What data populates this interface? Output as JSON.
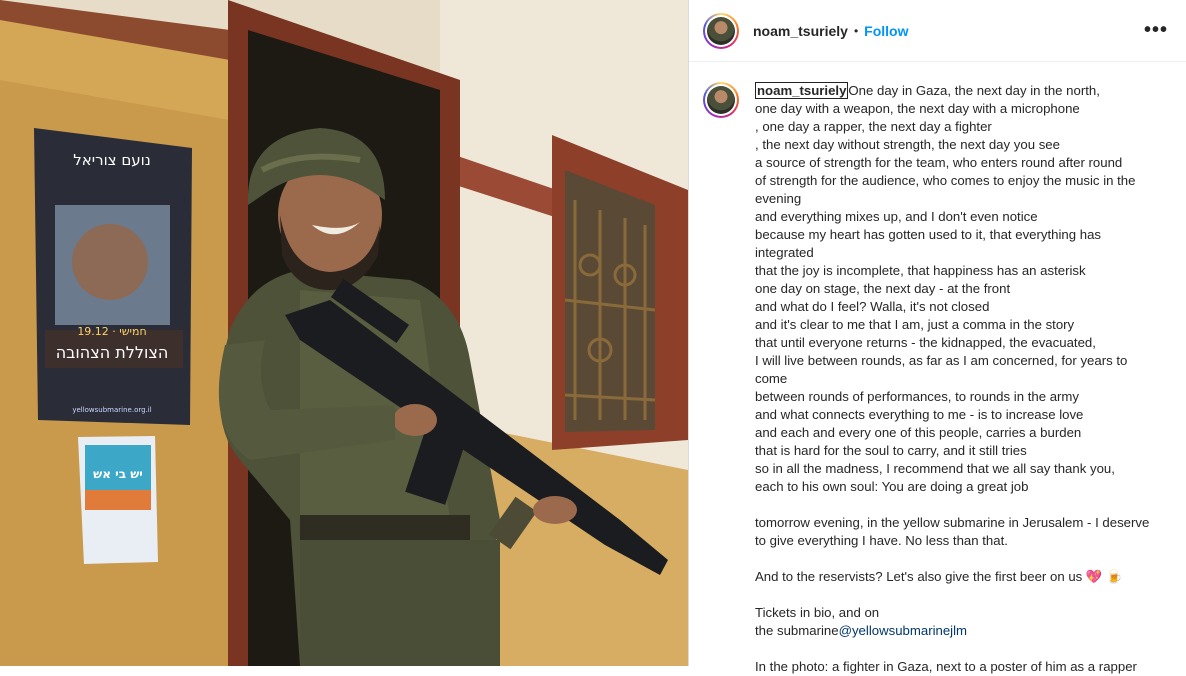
{
  "post": {
    "username": "noam_tsuriely",
    "separator": "•",
    "follow_label": "Follow",
    "more_icon": "more-options-icon",
    "more_glyph": "•••"
  },
  "photo": {
    "poster_heading": "נועם צוריאל",
    "poster_date": "19.12 · חמישי",
    "poster_title": "הצוללת הצהובה",
    "poster_url": "yellowsubmarine.org.il",
    "sticker_text": "יש בי אש"
  },
  "caption": {
    "lines": [
      "One day in Gaza, the next day in the north,",
      "one day with a weapon, the next day with a microphone",
      ", one day a rapper, the next day a fighter",
      ", the next day without strength, the next day you see",
      "a source of strength for the team, who enters round after round",
      "of strength for the audience, who comes to enjoy the music in the",
      "evening",
      "and everything mixes up, and I don't even notice",
      "because my heart has gotten used to it, that everything has",
      "integrated",
      "that the joy is incomplete, that happiness has an asterisk",
      "one day on stage, the next day - at the front",
      "and what do I feel? Walla, it's not closed",
      "and it's clear to me that I am, just a comma in the story",
      "that until everyone returns - the kidnapped, the evacuated,",
      "I will live between rounds, as far as I am concerned, for years to",
      "come",
      "between rounds of performances, to rounds in the army",
      "and what connects everything to me - is to increase love",
      "and each and every one of this people, carries a burden",
      "that is hard for the soul to carry, and it still tries",
      "so in all the madness, I recommend that we all say thank you,",
      "each to his own soul: You are doing a great job",
      "",
      "tomorrow evening, in the yellow submarine in Jerusalem - I deserve",
      "to give everything I have. No less than that."
    ],
    "reservists_line": "And to the reservists? Let's also give the first beer on us ",
    "reservists_emoji": "💖 🍺",
    "tickets_line": "Tickets in bio, and on",
    "submarine_prefix": "the submarine",
    "mention": "@yellowsubmarinejlm",
    "photo_note": "In the photo: a fighter in Gaza, next to a poster of him as a rapper"
  },
  "colors": {
    "follow": "#0095f6",
    "wall": "#c9a25a",
    "door": "#8a3d2a"
  }
}
